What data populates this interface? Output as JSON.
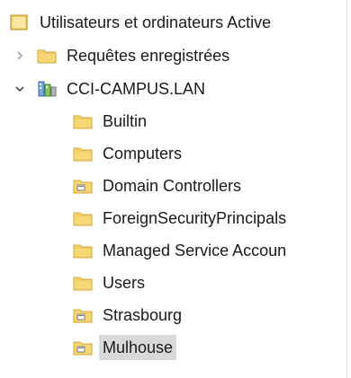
{
  "tree": {
    "root": {
      "label": "Utilisateurs et ordinateurs Active"
    },
    "saved_queries": {
      "label": "Requêtes enregistrées",
      "icon": "folder-icon"
    },
    "domain": {
      "label": "CCI-CAMPUS.LAN",
      "icon": "domain-icon",
      "children": [
        {
          "label": "Builtin",
          "icon": "folder-icon"
        },
        {
          "label": "Computers",
          "icon": "folder-icon"
        },
        {
          "label": "Domain Controllers",
          "icon": "ou-folder-icon"
        },
        {
          "label": "ForeignSecurityPrincipals",
          "icon": "folder-icon"
        },
        {
          "label": "Managed Service Accoun",
          "icon": "folder-icon"
        },
        {
          "label": "Users",
          "icon": "folder-icon"
        },
        {
          "label": "Strasbourg",
          "icon": "ou-folder-icon"
        },
        {
          "label": "Mulhouse",
          "icon": "ou-folder-icon",
          "selected": true
        }
      ]
    }
  },
  "colors": {
    "folder": "#f7d774",
    "folder_dark": "#e0b43c",
    "selection": "#d9d9d9"
  }
}
